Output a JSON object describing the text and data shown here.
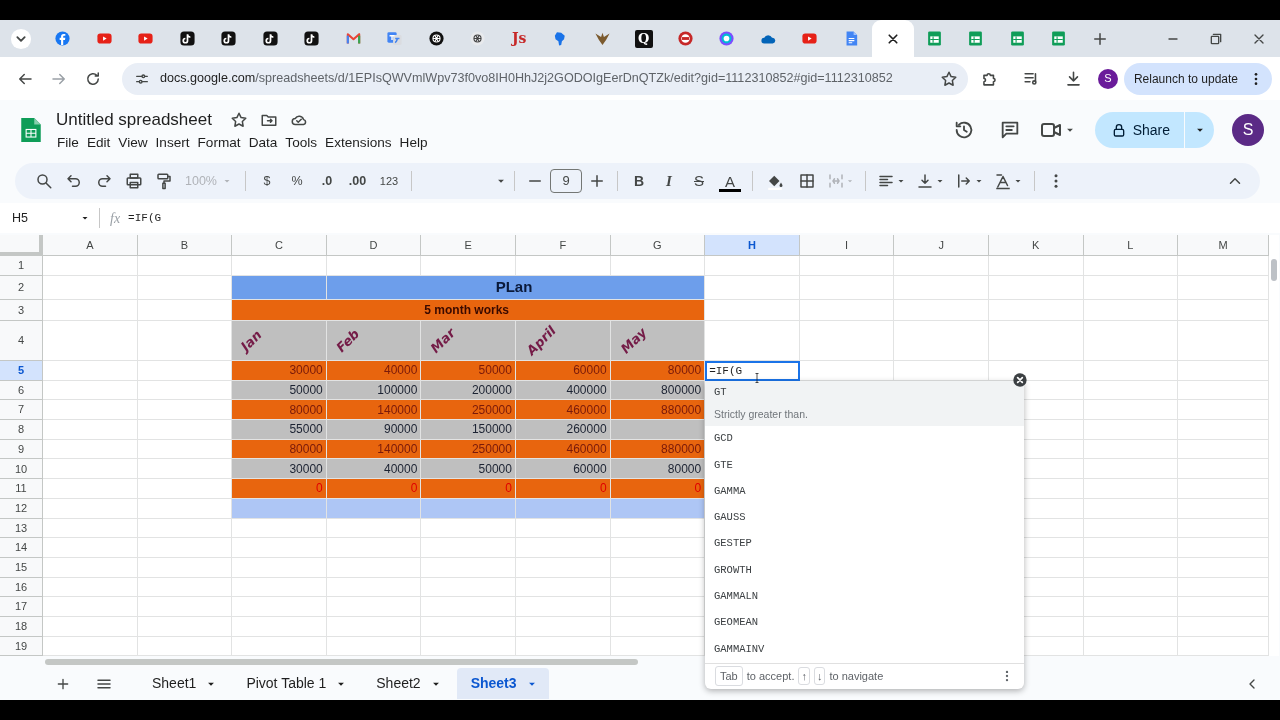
{
  "browser": {
    "tabs": [
      {
        "kind": "disc",
        "selected": false
      },
      {
        "kind": "play",
        "selected": false
      },
      {
        "kind": "play",
        "selected": false
      },
      {
        "kind": "note",
        "selected": false
      },
      {
        "kind": "note",
        "selected": false
      },
      {
        "kind": "note",
        "selected": false
      },
      {
        "kind": "note",
        "selected": false
      },
      {
        "kind": "mail",
        "selected": false
      },
      {
        "kind": "swap",
        "selected": false
      },
      {
        "kind": "knot",
        "selected": false
      },
      {
        "kind": "flower",
        "selected": false
      },
      {
        "kind": "letters",
        "text": "Js",
        "selected": false
      },
      {
        "kind": "map",
        "selected": false
      },
      {
        "kind": "emblem",
        "selected": false
      },
      {
        "kind": "letterbox",
        "text": "Q",
        "selected": false
      },
      {
        "kind": "seal",
        "selected": false
      },
      {
        "kind": "ring",
        "selected": false
      },
      {
        "kind": "cloud",
        "selected": false
      },
      {
        "kind": "play",
        "selected": false
      },
      {
        "kind": "page",
        "selected": false
      },
      {
        "kind": "current",
        "selected": true
      },
      {
        "kind": "grid",
        "selected": false
      },
      {
        "kind": "grid",
        "selected": false
      },
      {
        "kind": "grid",
        "selected": false
      },
      {
        "kind": "grid",
        "selected": false
      }
    ],
    "url": "docs.google.com/spreadsheets/d/1EPIsQWVmlWpv73f0vo8IH0HhJ2j2GODOIgEerDnQTZk/edit?gid=1112310852#gid=1112310852",
    "profile": "S",
    "relaunch": "Relaunch to update"
  },
  "app": {
    "title": "Untitled spreadsheet",
    "menu": [
      "File",
      "Edit",
      "View",
      "Insert",
      "Format",
      "Data",
      "Tools",
      "Extensions",
      "Help"
    ],
    "share": "Share",
    "avatar": "S"
  },
  "toolbar": {
    "zoom": "100%",
    "currency": "$",
    "percent": "%",
    "decrease_decimals": ".0",
    "increase_decimals": ".00",
    "number_format": "123",
    "font_size": "9",
    "bold": "B",
    "italic": "I",
    "strikethrough": "S",
    "text_color": "A"
  },
  "formula_bar": {
    "cell": "H5",
    "fx": "fx",
    "formula": "=IF(G"
  },
  "sheet": {
    "columns": [
      {
        "label": "A",
        "selected": false
      },
      {
        "label": "B",
        "selected": false
      },
      {
        "label": "C",
        "selected": false
      },
      {
        "label": "D",
        "selected": false
      },
      {
        "label": "E",
        "selected": false
      },
      {
        "label": "F",
        "selected": false
      },
      {
        "label": "G",
        "selected": false
      },
      {
        "label": "H",
        "selected": true
      },
      {
        "label": "I",
        "selected": false
      },
      {
        "label": "J",
        "selected": false
      },
      {
        "label": "K",
        "selected": false
      },
      {
        "label": "L",
        "selected": false
      },
      {
        "label": "M",
        "selected": false
      }
    ],
    "rows": [
      {
        "label": "1",
        "selected": false
      },
      {
        "label": "2",
        "selected": false
      },
      {
        "label": "3",
        "selected": false
      },
      {
        "label": "4",
        "selected": false
      },
      {
        "label": "5",
        "selected": true
      },
      {
        "label": "6",
        "selected": false
      },
      {
        "label": "7",
        "selected": false
      },
      {
        "label": "8",
        "selected": false
      },
      {
        "label": "9",
        "selected": false
      },
      {
        "label": "10",
        "selected": false
      },
      {
        "label": "11",
        "selected": false
      },
      {
        "label": "12",
        "selected": false
      },
      {
        "label": "13",
        "selected": false
      },
      {
        "label": "14",
        "selected": false
      },
      {
        "label": "15",
        "selected": false
      },
      {
        "label": "16",
        "selected": false
      },
      {
        "label": "17",
        "selected": false
      },
      {
        "label": "18",
        "selected": false
      },
      {
        "label": "19",
        "selected": false
      }
    ],
    "plan": {
      "title": {
        "text": "PLan",
        "color": "#6d9eeb"
      },
      "subtitle": {
        "text": "5 month works",
        "color": "#e8650e"
      },
      "months": {
        "color": "#bfbfbf",
        "items": [
          "Jan",
          "Feb",
          "Mar",
          "April",
          "May"
        ]
      },
      "rows": [
        {
          "kind": "highlight",
          "color": "#e8650e",
          "values": [
            "30000",
            "40000",
            "50000",
            "60000",
            "80000"
          ]
        },
        {
          "kind": "plain",
          "color": "#bfbfbf",
          "values": [
            "50000",
            "100000",
            "200000",
            "400000",
            "800000"
          ]
        },
        {
          "kind": "highlight",
          "color": "#e8650e",
          "values": [
            "80000",
            "140000",
            "250000",
            "460000",
            "880000"
          ]
        },
        {
          "kind": "plain",
          "color": "#bfbfbf",
          "values": [
            "55000",
            "90000",
            "150000",
            "260000"
          ]
        },
        {
          "kind": "highlight",
          "color": "#e8650e",
          "values": [
            "80000",
            "140000",
            "250000",
            "460000",
            "880000"
          ]
        },
        {
          "kind": "plain",
          "color": "#bfbfbf",
          "values": [
            "30000",
            "40000",
            "50000",
            "60000",
            "80000"
          ]
        },
        {
          "kind": "warning",
          "color": "#e8650e",
          "values": [
            "0",
            "0",
            "0",
            "0",
            "0"
          ]
        },
        {
          "kind": "plain",
          "color": "#aec6f5"
        }
      ]
    },
    "editor": "=IF(G"
  },
  "autocomplete": {
    "items": [
      {
        "name": "GT",
        "description": "Strictly greater than.",
        "selected": true
      },
      {
        "name": "GCD",
        "selected": false
      },
      {
        "name": "GTE",
        "selected": false
      },
      {
        "name": "GAMMA",
        "selected": false
      },
      {
        "name": "GAUSS",
        "selected": false
      },
      {
        "name": "GESTEP",
        "selected": false
      },
      {
        "name": "GROWTH",
        "selected": false
      },
      {
        "name": "GAMMALN",
        "selected": false
      },
      {
        "name": "GEOMEAN",
        "selected": false
      },
      {
        "name": "GAMMAINV",
        "selected": false
      }
    ],
    "key": "Tab",
    "accept": "to accept.",
    "up": "↑",
    "down": "↓",
    "navigate": "to navigate"
  },
  "sheet_tabs": [
    {
      "label": "Sheet1",
      "selected": false
    },
    {
      "label": "Pivot Table 1",
      "selected": false
    },
    {
      "label": "Sheet2",
      "selected": false
    },
    {
      "label": "Sheet3",
      "selected": true
    }
  ]
}
